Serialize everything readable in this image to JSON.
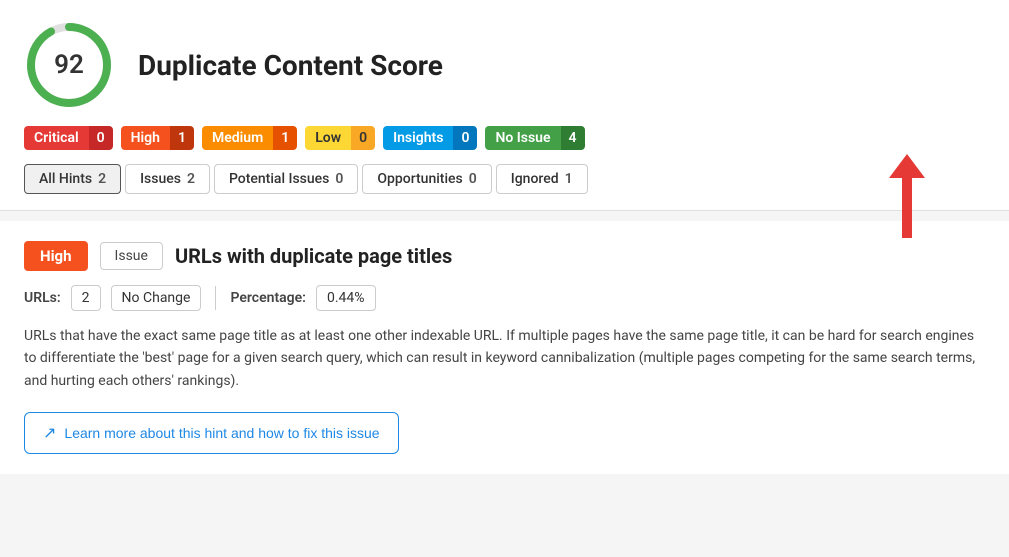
{
  "page": {
    "title": "Duplicate Content Score"
  },
  "score": {
    "value": "92",
    "donut_pct": 92
  },
  "badges": [
    {
      "key": "critical",
      "label": "Critical",
      "count": "0",
      "class": "badge-critical"
    },
    {
      "key": "high",
      "label": "High",
      "count": "1",
      "class": "badge-high"
    },
    {
      "key": "medium",
      "label": "Medium",
      "count": "1",
      "class": "badge-medium"
    },
    {
      "key": "low",
      "label": "Low",
      "count": "0",
      "class": "badge-low"
    },
    {
      "key": "insights",
      "label": "Insights",
      "count": "0",
      "class": "badge-insights"
    },
    {
      "key": "noissue",
      "label": "No Issue",
      "count": "4",
      "class": "badge-noissue"
    }
  ],
  "tabs": [
    {
      "key": "all-hints",
      "label": "All Hints",
      "count": "2",
      "active": true
    },
    {
      "key": "issues",
      "label": "Issues",
      "count": "2",
      "active": false
    },
    {
      "key": "potential-issues",
      "label": "Potential Issues",
      "count": "0",
      "active": false
    },
    {
      "key": "opportunities",
      "label": "Opportunities",
      "count": "0",
      "active": false
    },
    {
      "key": "ignored",
      "label": "Ignored",
      "count": "1",
      "active": false
    }
  ],
  "hint": {
    "severity": "High",
    "type": "Issue",
    "title": "URLs with duplicate page titles",
    "urls_label": "URLs:",
    "urls_count": "2",
    "urls_change": "No Change",
    "percentage_label": "Percentage:",
    "percentage_value": "0.44%",
    "description": "URLs that have the exact same page title as at least one other indexable URL. If multiple pages have the same page title, it can be hard for search engines to differentiate the 'best' page for a given search query, which can result in keyword cannibalization (multiple pages competing for the same search terms, and hurting each others' rankings).",
    "learn_more_label": "Learn more about this hint and how to fix this issue"
  },
  "arrow": {
    "color": "#e53935"
  }
}
